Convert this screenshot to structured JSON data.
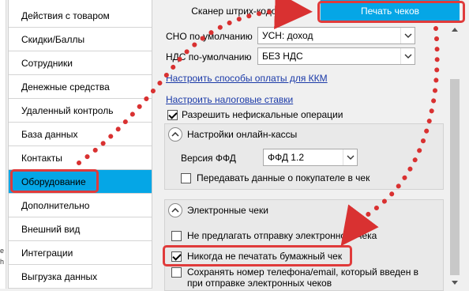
{
  "sidebar": {
    "items": [
      {
        "label": "Действия с товаром"
      },
      {
        "label": "Скидки/Баллы"
      },
      {
        "label": "Сотрудники"
      },
      {
        "label": "Денежные средства"
      },
      {
        "label": "Удаленный контроль"
      },
      {
        "label": "База данных"
      },
      {
        "label": "Контакты"
      },
      {
        "label": "Оборудование"
      },
      {
        "label": "Дополнительно"
      },
      {
        "label": "Внешний вид"
      },
      {
        "label": "Интеграции"
      },
      {
        "label": "Выгрузка данных"
      }
    ],
    "selected_index": 7
  },
  "left_fragments": {
    "a": "е",
    "b": "h"
  },
  "tabs": {
    "scanner": "Сканер штрих-кодов",
    "print": "Печать чеков"
  },
  "settings": {
    "sno_label": "СНО по-умолчанию",
    "sno_value": "УСН: доход",
    "nds_label": "НДС по-умолчанию",
    "nds_value": "БЕЗ НДС",
    "link_payment": "Настроить способы оплаты для ККМ",
    "link_tax": "Настроить налоговые ставки",
    "allow_nonfiscal": {
      "label": "Разрешить нефискальные операции",
      "checked": true
    }
  },
  "online_group": {
    "title": "Настройки онлайн-кассы",
    "ffd_label": "Версия ФФД",
    "ffd_value": "ФФД 1.2",
    "send_buyer": {
      "label": "Передавать данные о покупателе в чек",
      "checked": false
    }
  },
  "electronic_group": {
    "title": "Электронные чеки",
    "no_offer": {
      "label": "Не предлагать отправку электронного чека",
      "checked": false
    },
    "never_print": {
      "label": "Никогда не печатать бумажный чек",
      "checked": true
    },
    "save_contact": {
      "label_line1": "Сохранять номер телефона/email, который введен в",
      "label_line2": "при отправке электронных чеков",
      "checked": false
    }
  },
  "colors": {
    "accent": "#05a6e6",
    "highlight": "#e03b3b",
    "link": "#1b3aa8"
  }
}
